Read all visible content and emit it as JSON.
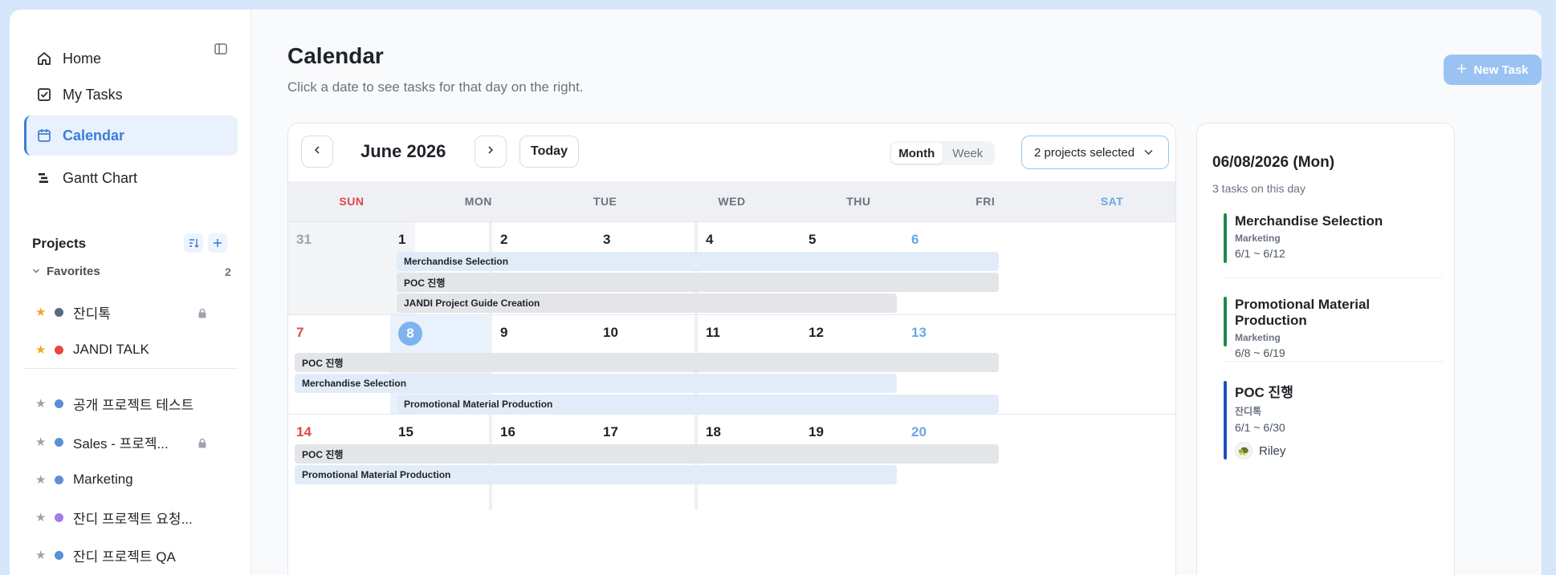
{
  "sidebar": {
    "nav": [
      {
        "label": "Home",
        "icon": "home-icon"
      },
      {
        "label": "My Tasks",
        "icon": "check-square-icon"
      },
      {
        "label": "Calendar",
        "icon": "calendar-icon"
      },
      {
        "label": "Gantt Chart",
        "icon": "gantt-icon"
      }
    ],
    "projects_title": "Projects",
    "favorites_label": "Favorites",
    "favorites_count": "2",
    "favorites": [
      {
        "name": "잔디톡",
        "color": "#5b6b7f",
        "locked": true
      },
      {
        "name": "JANDI TALK",
        "color": "#e84545",
        "locked": false
      }
    ],
    "projects": [
      {
        "name": "공개 프로젝트 테스트",
        "color": "#5d8fd8",
        "locked": false
      },
      {
        "name": "Sales - 프로젝...",
        "color": "#5d8fd8",
        "locked": true
      },
      {
        "name": "Marketing",
        "color": "#5d8fd8",
        "locked": false
      },
      {
        "name": "잔디 프로젝트 요청...",
        "color": "#a47be8",
        "locked": false
      },
      {
        "name": "잔디 프로젝트 QA",
        "color": "#5d8fd8",
        "locked": false
      }
    ]
  },
  "header": {
    "title": "Calendar",
    "subtitle": "Click a date to see tasks for that day on the right.",
    "new_task_label": "New Task"
  },
  "calendar": {
    "month_label": "June 2026",
    "today_label": "Today",
    "view_month": "Month",
    "view_week": "Week",
    "project_filter": "2 projects selected",
    "weekdays": [
      "SUN",
      "MON",
      "TUE",
      "WED",
      "THU",
      "FRI",
      "SAT"
    ],
    "weeks": [
      [
        "31",
        "1",
        "2",
        "3",
        "4",
        "5",
        "6"
      ],
      [
        "7",
        "8",
        "9",
        "10",
        "11",
        "12",
        "13"
      ],
      [
        "14",
        "15",
        "16",
        "17",
        "18",
        "19",
        "20"
      ]
    ],
    "selected_date": "8",
    "events": {
      "merch": "Merchandise Selection",
      "poc": "POC 진행",
      "guide": "JANDI Project Guide Creation",
      "promo": "Promotional Material Production"
    }
  },
  "panel": {
    "date": "06/08/2026 (Mon)",
    "count_text": "3 tasks on this day",
    "tasks": [
      {
        "title": "Merchandise Selection",
        "project": "Marketing",
        "dates": "6/1 ~ 6/12",
        "accent": "#1f8a4c"
      },
      {
        "title": "Promotional Material Production",
        "project": "Marketing",
        "dates": "6/8 ~ 6/19",
        "accent": "#1f8a4c"
      },
      {
        "title": "POC 진행",
        "project": "잔디톡",
        "dates": "6/1 ~ 6/30",
        "accent": "#1e4fc2",
        "assignee": "Riley"
      }
    ]
  },
  "colors": {
    "accent": "#3b7ed6",
    "sunday": "#e04848",
    "saturday": "#6aa6e8",
    "event_blue": "#e2ecf9",
    "event_gray": "#e3e5e8"
  }
}
